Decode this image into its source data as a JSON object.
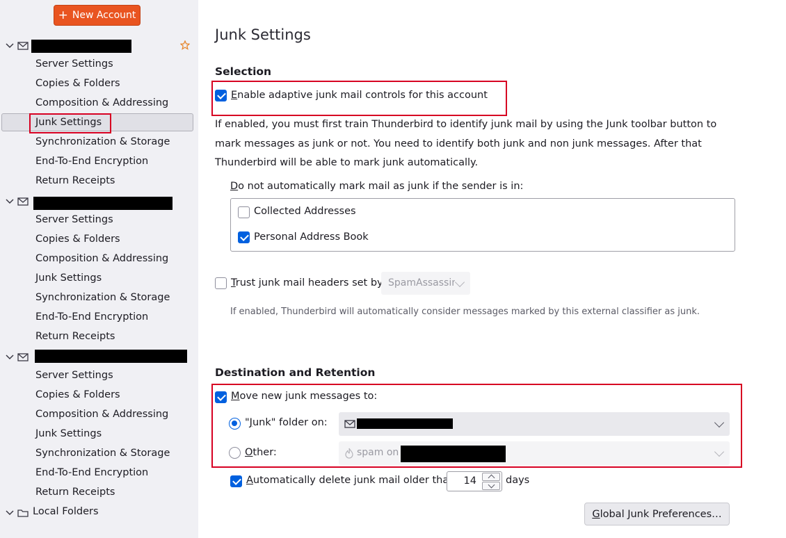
{
  "sidebar": {
    "new_account_label": "New Account",
    "accounts": [
      {
        "items": [
          "Server Settings",
          "Copies & Folders",
          "Composition & Addressing",
          "Junk Settings",
          "Synchronization & Storage",
          "End-To-End Encryption",
          "Return Receipts"
        ],
        "selected": "Junk Settings"
      },
      {
        "items": [
          "Server Settings",
          "Copies & Folders",
          "Composition & Addressing",
          "Junk Settings",
          "Synchronization & Storage",
          "End-To-End Encryption",
          "Return Receipts"
        ]
      },
      {
        "items": [
          "Server Settings",
          "Copies & Folders",
          "Composition & Addressing",
          "Junk Settings",
          "Synchronization & Storage",
          "End-To-End Encryption",
          "Return Receipts"
        ]
      }
    ],
    "local_folders_label": "Local Folders"
  },
  "main": {
    "title": "Junk Settings",
    "selection": {
      "heading": "Selection",
      "enable_label_underlined": "E",
      "enable_label_rest": "nable adaptive junk mail controls for this account",
      "enable_checked": true,
      "description": "If enabled, you must first train Thunderbird to identify junk mail by using the Junk toolbar button to mark messages as junk or not. You need to identify both junk and non junk messages. After that Thunderbird will be able to mark junk automatically.",
      "whitelist_label_underlined": "D",
      "whitelist_label_rest": "o not automatically mark mail as junk if the sender is in:",
      "address_books": [
        {
          "label": "Collected Addresses",
          "checked": false
        },
        {
          "label": "Personal Address Book",
          "checked": true
        }
      ],
      "trust_label_underlined": "T",
      "trust_label_rest": "rust junk mail headers set by:",
      "trust_checked": false,
      "trust_select_value": "SpamAssassin",
      "trust_note": "If enabled, Thunderbird will automatically consider messages marked by this external classifier as junk."
    },
    "destination": {
      "heading": "Destination and Retention",
      "move_label_underlined": "M",
      "move_label_rest": "ove new junk messages to:",
      "move_checked": true,
      "junk_folder_label_pre": "\"",
      "junk_folder_label_underlined": "J",
      "junk_folder_label_rest": "unk\" folder on:",
      "junk_folder_selected": true,
      "other_label_underlined": "O",
      "other_label_rest": "ther:",
      "other_select_prefix": "spam on",
      "auto_delete_label_underlined": "A",
      "auto_delete_label_rest": "utomatically delete junk mail older than",
      "auto_delete_checked": true,
      "auto_delete_days": "14",
      "days_label": "days",
      "global_prefs_underlined": "G",
      "global_prefs_rest": "lobal Junk Preferences…"
    }
  },
  "colors": {
    "accent": "#0060df",
    "new_account_bg": "#e95420",
    "highlight_box": "#d70022"
  }
}
